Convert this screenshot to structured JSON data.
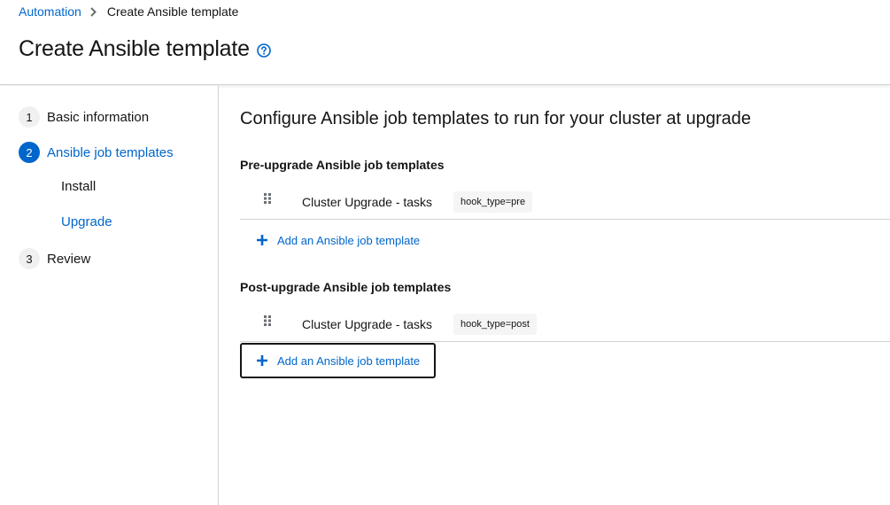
{
  "breadcrumb": {
    "parent": "Automation",
    "current": "Create Ansible template"
  },
  "page": {
    "title": "Create Ansible template",
    "help_icon": "question-circle-icon"
  },
  "wizard_nav": {
    "steps": [
      {
        "number": "1",
        "label": "Basic information",
        "active": false
      },
      {
        "number": "2",
        "label": "Ansible job templates",
        "active": true
      },
      {
        "number": "3",
        "label": "Review",
        "active": false
      }
    ],
    "substeps": [
      {
        "label": "Install",
        "active": false
      },
      {
        "label": "Upgrade",
        "active": true
      }
    ]
  },
  "main": {
    "title": "Configure Ansible job templates to run for your cluster at upgrade",
    "pre_upgrade": {
      "title": "Pre-upgrade Ansible job templates",
      "rows": [
        {
          "name": "Cluster Upgrade - tasks",
          "label": "hook_type=pre"
        }
      ],
      "add_label": "Add an Ansible job template"
    },
    "post_upgrade": {
      "title": "Post-upgrade Ansible job templates",
      "rows": [
        {
          "name": "Cluster Upgrade - tasks",
          "label": "hook_type=post"
        }
      ],
      "add_label": "Add an Ansible job template"
    }
  },
  "colors": {
    "link": "#0066cc",
    "text": "#151515",
    "border": "#d2d2d2"
  }
}
